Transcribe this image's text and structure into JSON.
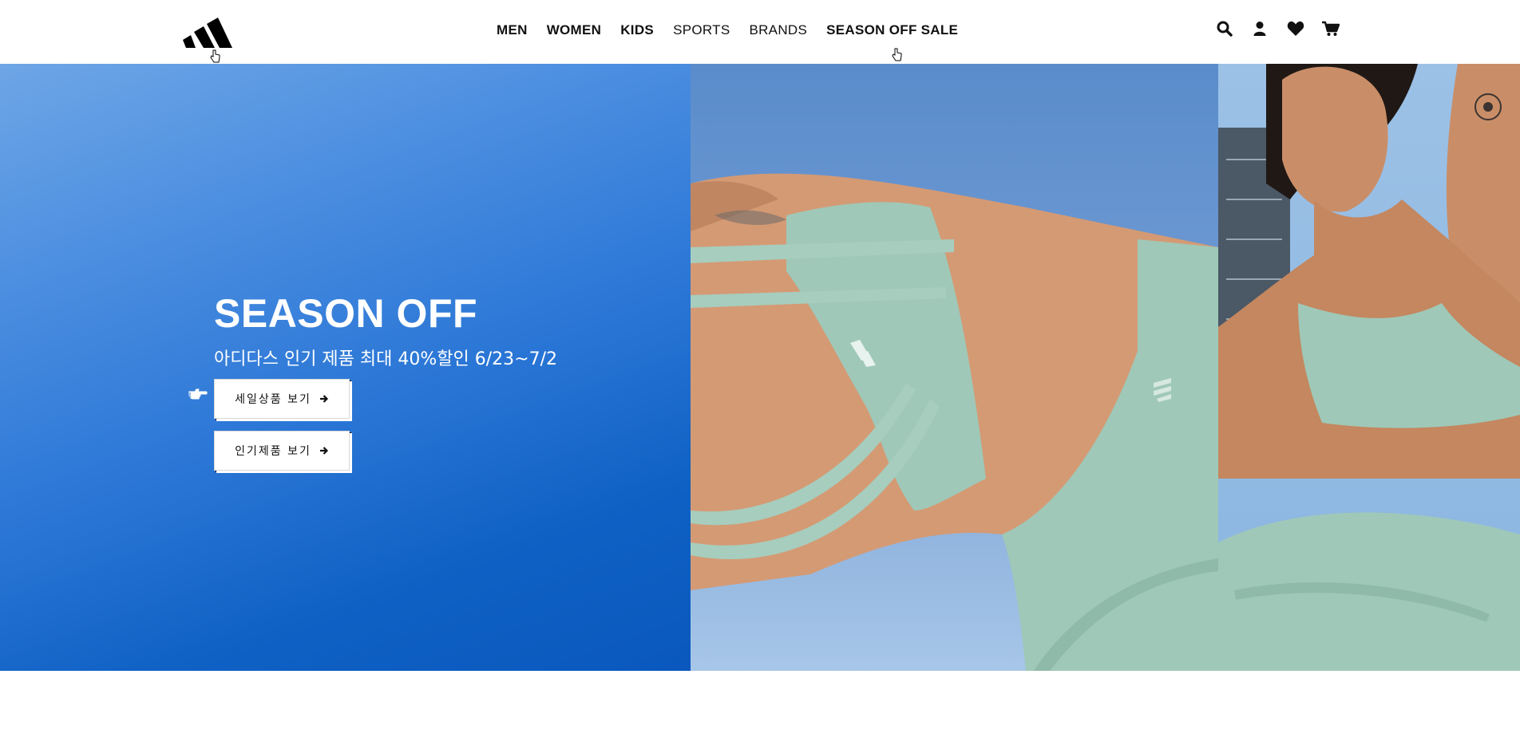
{
  "header": {
    "logo_icon": "adidas-logo-icon",
    "nav": [
      {
        "label": "MEN",
        "bold": true
      },
      {
        "label": "WOMEN",
        "bold": true
      },
      {
        "label": "KIDS",
        "bold": true
      },
      {
        "label": "SPORTS",
        "bold": false
      },
      {
        "label": "BRANDS",
        "bold": false
      },
      {
        "label": "SEASON OFF SALE",
        "bold": true
      }
    ],
    "icons": [
      "search-icon",
      "user-icon",
      "heart-icon",
      "cart-icon"
    ]
  },
  "hero": {
    "title": "SEASON OFF",
    "subtitle": "아디다스 인기 제품 최대 40%할인 6/23~7/2",
    "buttons": [
      {
        "label": "세일상품 보기",
        "icon": "arrow-right-icon"
      },
      {
        "label": "인기제품 보기",
        "icon": "arrow-right-icon"
      }
    ],
    "colors": {
      "left_panel": "#2a76d6",
      "apparel": "#9fc8b8"
    }
  }
}
